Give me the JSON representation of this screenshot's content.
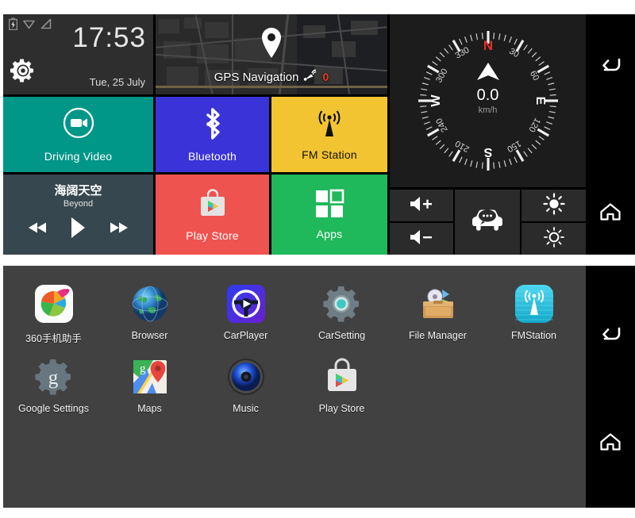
{
  "home": {
    "status_icons": [
      "battery-charging-icon",
      "wifi-icon",
      "signal-icon"
    ],
    "clock": {
      "time": "17:53",
      "date": "Tue, 25 July",
      "settings_icon": "gear-icon"
    },
    "gps": {
      "label": "GPS Navigation",
      "satellite_count": "0",
      "pin_icon": "location-pin-icon",
      "satellite_icon": "satellite-dish-icon"
    },
    "compass": {
      "cardinals": [
        "N",
        "E",
        "S",
        "W"
      ],
      "degrees": [
        "30",
        "60",
        "120",
        "150",
        "210",
        "240",
        "300",
        "330"
      ],
      "speed": "0.0",
      "unit": "km/h",
      "north_color": "#e0302a",
      "needle_icon": "compass-needle-icon"
    },
    "tiles": [
      {
        "label": "Driving Video",
        "icon": "video-camera-icon",
        "color": "#009688"
      },
      {
        "label": "Bluetooth",
        "icon": "bluetooth-icon",
        "color": "#3a33d8"
      },
      {
        "label": "FM Station",
        "icon": "radio-tower-icon",
        "color": "#f3c431"
      },
      {
        "label": "Play Store",
        "icon": "play-store-bag-icon",
        "color": "#ef5350"
      },
      {
        "label": "Apps",
        "icon": "apps-grid-icon",
        "color": "#1fb85a"
      }
    ],
    "music": {
      "title": "海阔天空",
      "artist": "Beyond",
      "prev_icon": "previous-track-icon",
      "play_icon": "play-icon",
      "next_icon": "next-track-icon"
    },
    "buttons": [
      {
        "name": "volume-up",
        "icon": "volume-up-icon"
      },
      {
        "name": "volume-down",
        "icon": "volume-down-icon"
      },
      {
        "name": "voice-assistant",
        "icon": "car-voice-icon"
      },
      {
        "name": "brightness-up",
        "icon": "brightness-high-icon"
      },
      {
        "name": "brightness-down",
        "icon": "brightness-low-icon"
      }
    ],
    "nav": {
      "back_icon": "back-arrow-icon",
      "home_icon": "home-icon"
    }
  },
  "drawer": {
    "nav": {
      "back_icon": "back-arrow-icon",
      "home_icon": "home-icon"
    },
    "rows": [
      [
        {
          "label": "360手机助手",
          "icon": "360-assistant-icon"
        },
        {
          "label": "Browser",
          "icon": "globe-browser-icon"
        },
        {
          "label": "CarPlayer",
          "icon": "carplayer-icon"
        },
        {
          "label": "CarSetting",
          "icon": "car-setting-gear-icon"
        },
        {
          "label": "File Manager",
          "icon": "file-manager-box-icon"
        },
        {
          "label": "FMStation",
          "icon": "fm-tower-icon"
        }
      ],
      [
        {
          "label": "Google Settings",
          "icon": "google-settings-gear-icon"
        },
        {
          "label": "Maps",
          "icon": "google-maps-icon"
        },
        {
          "label": "Music",
          "icon": "music-speaker-icon"
        },
        {
          "label": "Play Store",
          "icon": "play-store-bag-icon"
        }
      ]
    ]
  }
}
